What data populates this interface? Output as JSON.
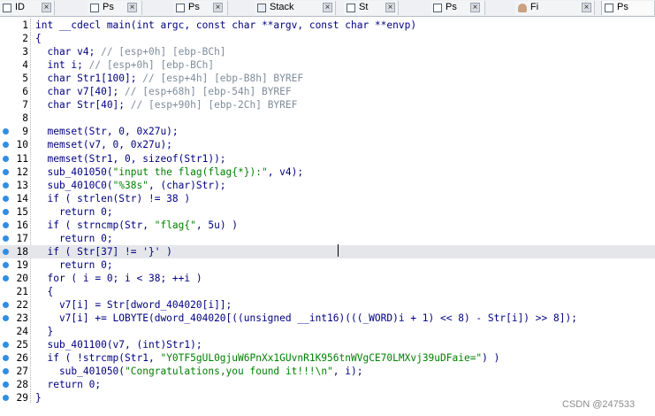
{
  "tabs": [
    {
      "label": "ID",
      "icon": "document-icon",
      "active": false
    },
    {
      "label": "Ps",
      "icon": "document-icon",
      "active": false
    },
    {
      "label": "Ps",
      "icon": "document-icon",
      "active": false
    },
    {
      "label": "Stack",
      "icon": "stack-icon",
      "active": false
    },
    {
      "label": "St",
      "icon": "document-icon",
      "active": false
    },
    {
      "label": "Ps",
      "icon": "document-icon",
      "active": false
    },
    {
      "label": "Fi",
      "icon": "person-icon",
      "active": false
    },
    {
      "label": "Ps",
      "icon": "document-icon",
      "active": true
    }
  ],
  "tab_close_glyph": "×",
  "code_lines": [
    {
      "n": "1",
      "text": "int __cdecl main(int argc, const char **argv, const char **envp)",
      "dot": false
    },
    {
      "n": "2",
      "text": "{",
      "dot": false
    },
    {
      "n": "3",
      "text": "  char v4; // [esp+0h] [ebp-BCh]",
      "dot": false
    },
    {
      "n": "4",
      "text": "  int i; // [esp+0h] [ebp-BCh]",
      "dot": false
    },
    {
      "n": "5",
      "text": "  char Str1[100]; // [esp+4h] [ebp-B8h] BYREF",
      "dot": false
    },
    {
      "n": "6",
      "text": "  char v7[40]; // [esp+68h] [ebp-54h] BYREF",
      "dot": false
    },
    {
      "n": "7",
      "text": "  char Str[40]; // [esp+90h] [ebp-2Ch] BYREF",
      "dot": false
    },
    {
      "n": "8",
      "text": "",
      "dot": false
    },
    {
      "n": "9",
      "text": "  memset(Str, 0, 0x27u);",
      "dot": true
    },
    {
      "n": "10",
      "text": "  memset(v7, 0, 0x27u);",
      "dot": true
    },
    {
      "n": "11",
      "text": "  memset(Str1, 0, sizeof(Str1));",
      "dot": true
    },
    {
      "n": "12",
      "text": "  sub_401050(\"input the flag(flag{*}):\", v4);",
      "dot": true
    },
    {
      "n": "13",
      "text": "  sub_4010C0(\"%38s\", (char)Str);",
      "dot": true
    },
    {
      "n": "14",
      "text": "  if ( strlen(Str) != 38 )",
      "dot": true
    },
    {
      "n": "15",
      "text": "    return 0;",
      "dot": true
    },
    {
      "n": "16",
      "text": "  if ( strncmp(Str, \"flag{\", 5u) )",
      "dot": true
    },
    {
      "n": "17",
      "text": "    return 0;",
      "dot": true
    },
    {
      "n": "18",
      "text": "  if ( Str[37] != '}' )",
      "dot": true,
      "highlight": true
    },
    {
      "n": "19",
      "text": "    return 0;",
      "dot": true
    },
    {
      "n": "20",
      "text": "  for ( i = 0; i < 38; ++i )",
      "dot": true
    },
    {
      "n": "21",
      "text": "  {",
      "dot": false
    },
    {
      "n": "22",
      "text": "    v7[i] = Str[dword_404020[i]];",
      "dot": true
    },
    {
      "n": "23",
      "text": "    v7[i] += LOBYTE(dword_404020[((unsigned __int16)(((_WORD)i + 1) << 8) - Str[i]) >> 8]);",
      "dot": true
    },
    {
      "n": "24",
      "text": "  }",
      "dot": false
    },
    {
      "n": "25",
      "text": "  sub_401100(v7, (int)Str1);",
      "dot": true
    },
    {
      "n": "26",
      "text": "  if ( !strcmp(Str1, \"Y0TF5gUL0gjuW6PnXx1GUvnR1K956tnWVgCE70LMXvj39uDFaie=\") )",
      "dot": true
    },
    {
      "n": "27",
      "text": "    sub_401050(\"Congratulations,you found it!!!\\n\", i);",
      "dot": true
    },
    {
      "n": "28",
      "text": "  return 0;",
      "dot": true
    },
    {
      "n": "29",
      "text": "}",
      "dot": true
    }
  ],
  "watermark": "CSDN @247533",
  "colors": {
    "code_text": "#000080",
    "comment": "#7f8c9a",
    "string": "#008000",
    "breakpoint_dot": "#2e8ee6",
    "highlight_line": "#e4e6ea"
  }
}
